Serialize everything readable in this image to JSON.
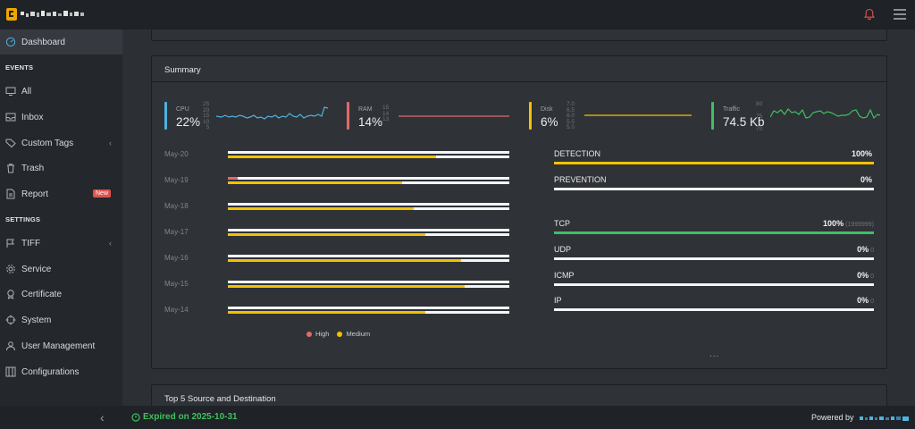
{
  "topbar": {
    "logo_icon": "pixelated-brand-logo",
    "alert_icon": "bell-icon",
    "menu_icon": "hamburger-icon"
  },
  "sidebar": {
    "items": [
      {
        "label": "Dashboard",
        "icon": "dashboard-icon"
      },
      {
        "label": "All",
        "icon": "monitor-icon"
      },
      {
        "label": "Inbox",
        "icon": "inbox-icon"
      },
      {
        "label": "Custom Tags",
        "icon": "tag-icon"
      },
      {
        "label": "Trash",
        "icon": "trash-icon"
      },
      {
        "label": "Report",
        "icon": "report-icon",
        "badge": "New"
      },
      {
        "label": "TIFF",
        "icon": "flag-icon"
      },
      {
        "label": "Service",
        "icon": "gear-icon"
      },
      {
        "label": "Certificate",
        "icon": "certificate-icon"
      },
      {
        "label": "System",
        "icon": "crosshair-icon"
      },
      {
        "label": "User Management",
        "icon": "users-icon"
      },
      {
        "label": "Configurations",
        "icon": "sliders-icon"
      }
    ],
    "sections": {
      "events": "EVENTS",
      "settings": "SETTINGS"
    }
  },
  "footer": {
    "expired": "Expired on 2025-10-31",
    "powered_by": "Powered by"
  },
  "summary": {
    "title": "Summary",
    "metrics": [
      {
        "label": "CPU",
        "value": "22%",
        "ticks": [
          "25",
          "20",
          "15",
          "10",
          "5"
        ],
        "color": "#4fb3e0"
      },
      {
        "label": "RAM",
        "value": "14%",
        "ticks": [
          "15",
          "14",
          "13"
        ],
        "color": "#e16a6a"
      },
      {
        "label": "Disk",
        "value": "6%",
        "ticks": [
          "7.0",
          "6.5",
          "6.0",
          "5.5",
          "5.0"
        ],
        "color": "#f2c200"
      },
      {
        "label": "Traffic",
        "value": "74.5 Kb",
        "ticks": [
          "80",
          "75",
          "70"
        ],
        "color": "#3fbf62"
      }
    ],
    "timeline": [
      {
        "date": "May-20",
        "high": 0.0,
        "medium": 0.74
      },
      {
        "date": "May-19",
        "high": 0.035,
        "medium": 0.62
      },
      {
        "date": "May-18",
        "high": 0.0,
        "medium": 0.66
      },
      {
        "date": "May-17",
        "high": 0.0,
        "medium": 0.7
      },
      {
        "date": "May-16",
        "high": 0.0,
        "medium": 0.83
      },
      {
        "date": "May-15",
        "high": 0.0,
        "medium": 0.84
      },
      {
        "date": "May-14",
        "high": 0.0,
        "medium": 0.7
      }
    ],
    "legend": [
      {
        "label": "High",
        "color": "#e16a6a"
      },
      {
        "label": "Medium",
        "color": "#f2c200"
      }
    ],
    "progress": [
      {
        "name": "DETECTION",
        "pct": "100%",
        "extra": "",
        "fill": 1.0,
        "color": "#f2c200"
      },
      {
        "name": "PREVENTION",
        "pct": "0%",
        "extra": "",
        "fill": 0.0,
        "color": "#f2c200"
      },
      {
        "name": "TCP",
        "pct": "100%",
        "extra": "(1999999)",
        "fill": 1.0,
        "color": "#3fbf62"
      },
      {
        "name": "UDP",
        "pct": "0%",
        "extra": "0",
        "fill": 0.0,
        "color": "#3fbf62"
      },
      {
        "name": "ICMP",
        "pct": "0%",
        "extra": "0",
        "fill": 0.0,
        "color": "#3fbf62"
      },
      {
        "name": "IP",
        "pct": "0%",
        "extra": "0",
        "fill": 0.0,
        "color": "#3fbf62"
      }
    ],
    "more": "..."
  },
  "top5": {
    "title": "Top 5 Source and Destination"
  },
  "colors": {
    "bg": "#2c2f34",
    "sidebar": "#24272b",
    "accent_green": "#3fc15f"
  }
}
